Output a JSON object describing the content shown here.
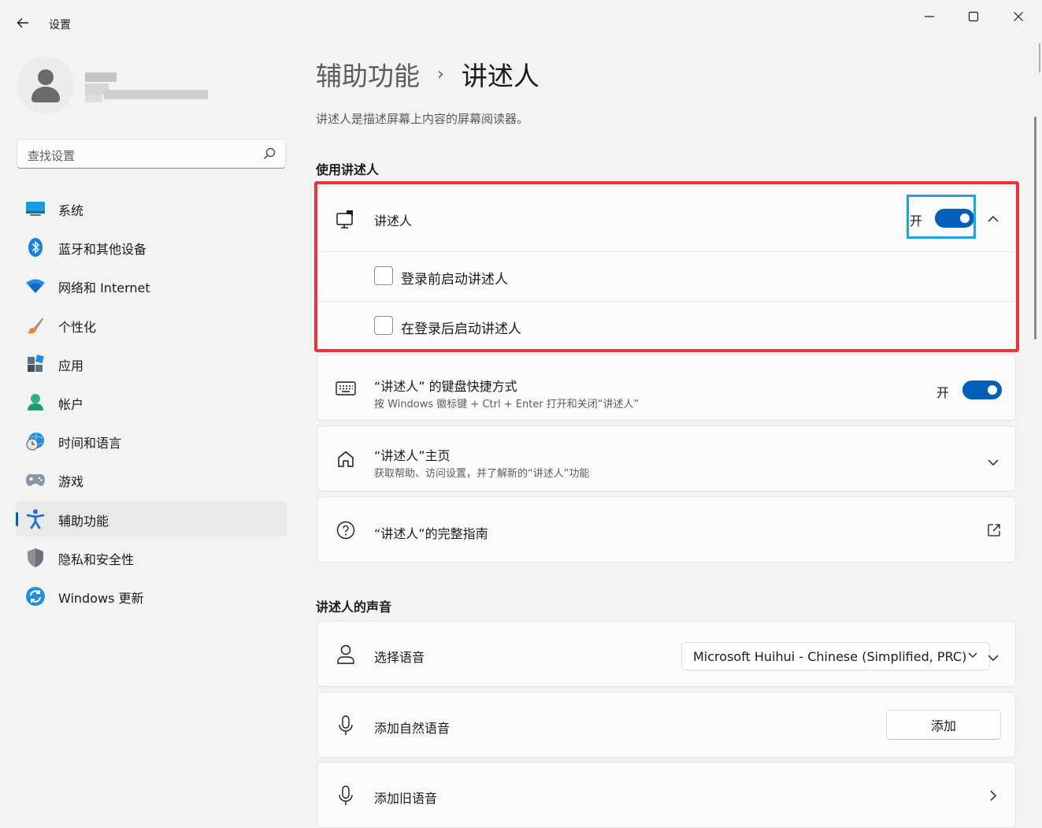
{
  "window": {
    "app_title": "设置",
    "controls": {
      "minimize": "minimize-icon",
      "maximize": "maximize-icon",
      "close": "close-icon"
    }
  },
  "sidebar": {
    "search_placeholder": "查找设置",
    "items": [
      {
        "label": "系统",
        "icon": "system-icon"
      },
      {
        "label": "蓝牙和其他设备",
        "icon": "bluetooth-icon"
      },
      {
        "label": "网络和 Internet",
        "icon": "wifi-icon"
      },
      {
        "label": "个性化",
        "icon": "brush-icon"
      },
      {
        "label": "应用",
        "icon": "apps-icon"
      },
      {
        "label": "帐户",
        "icon": "account-icon"
      },
      {
        "label": "时间和语言",
        "icon": "time-language-icon"
      },
      {
        "label": "游戏",
        "icon": "gamepad-icon"
      },
      {
        "label": "辅助功能",
        "icon": "accessibility-icon",
        "active": true
      },
      {
        "label": "隐私和安全性",
        "icon": "shield-icon"
      },
      {
        "label": "Windows 更新",
        "icon": "windows-update-icon"
      }
    ]
  },
  "main": {
    "breadcrumb_parent": "辅助功能",
    "breadcrumb_separator": "›",
    "breadcrumb_current": "讲述人",
    "description": "讲述人是描述屏幕上内容的屏幕阅读器。",
    "section_use": "使用讲述人",
    "narrator": {
      "title": "讲述人",
      "toggle_label": "开",
      "toggle_on": true,
      "option_before_login": "登录前启动讲述人",
      "option_after_login": "在登录后启动讲述人"
    },
    "shortcut": {
      "title": "“讲述人” 的键盘快捷方式",
      "subtitle": "按 Windows 徽标键 + Ctrl + Enter 打开和关闭“讲述人”",
      "toggle_label": "开",
      "toggle_on": true
    },
    "home": {
      "title": "“讲述人”主页",
      "subtitle": "获取帮助、访问设置，并了解新的“讲述人”功能"
    },
    "guide": {
      "title": "“讲述人”的完整指南"
    },
    "section_voice": "讲述人的声音",
    "voice": {
      "title": "选择语音",
      "selected": "Microsoft Huihui - Chinese (Simplified, PRC)"
    },
    "natural_voice": {
      "title": "添加自然语音",
      "button": "添加"
    },
    "legacy_voice": {
      "title": "添加旧语音"
    }
  },
  "colors": {
    "accent": "#005fb8",
    "highlight_red": "#e8343f",
    "highlight_blue": "#1aa6e0"
  }
}
